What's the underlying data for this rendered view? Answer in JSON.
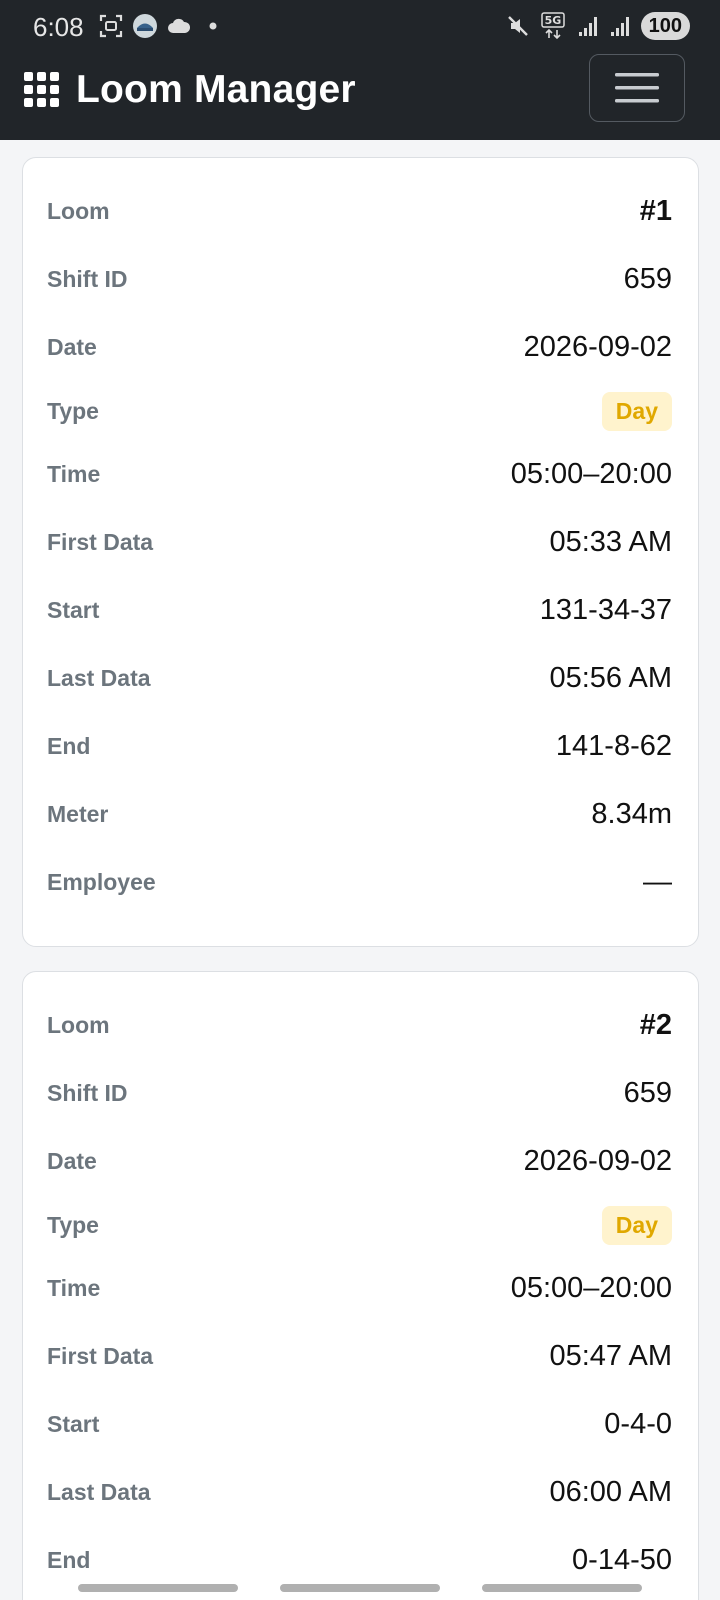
{
  "status": {
    "time": "6:08",
    "battery": "100",
    "network": "5G"
  },
  "header": {
    "title": "Loom Manager",
    "menu_icon": "hamburger-icon",
    "brand_icon": "grid-apps-icon"
  },
  "colors": {
    "navbar": "#212529",
    "badge_bg": "#fff3cd",
    "badge_text": "#e0a800",
    "label": "#6c757d"
  },
  "labels": {
    "loom": "Loom",
    "shift_id": "Shift ID",
    "date": "Date",
    "type": "Type",
    "time": "Time",
    "first_data": "First Data",
    "start": "Start",
    "last_data": "Last Data",
    "end": "End",
    "meter": "Meter",
    "employee": "Employee"
  },
  "records": [
    {
      "loom": "#1",
      "shift_id": "659",
      "date": "2026-09-02",
      "type": "Day",
      "time": "05:00–20:00",
      "first_data": "05:33 AM",
      "start": "131-34-37",
      "last_data": "05:56 AM",
      "end": "141-8-62",
      "meter": "8.34m",
      "employee": "—"
    },
    {
      "loom": "#2",
      "shift_id": "659",
      "date": "2026-09-02",
      "type": "Day",
      "time": "05:00–20:00",
      "first_data": "05:47 AM",
      "start": "0-4-0",
      "last_data": "06:00 AM",
      "end": "0-14-50"
    }
  ]
}
